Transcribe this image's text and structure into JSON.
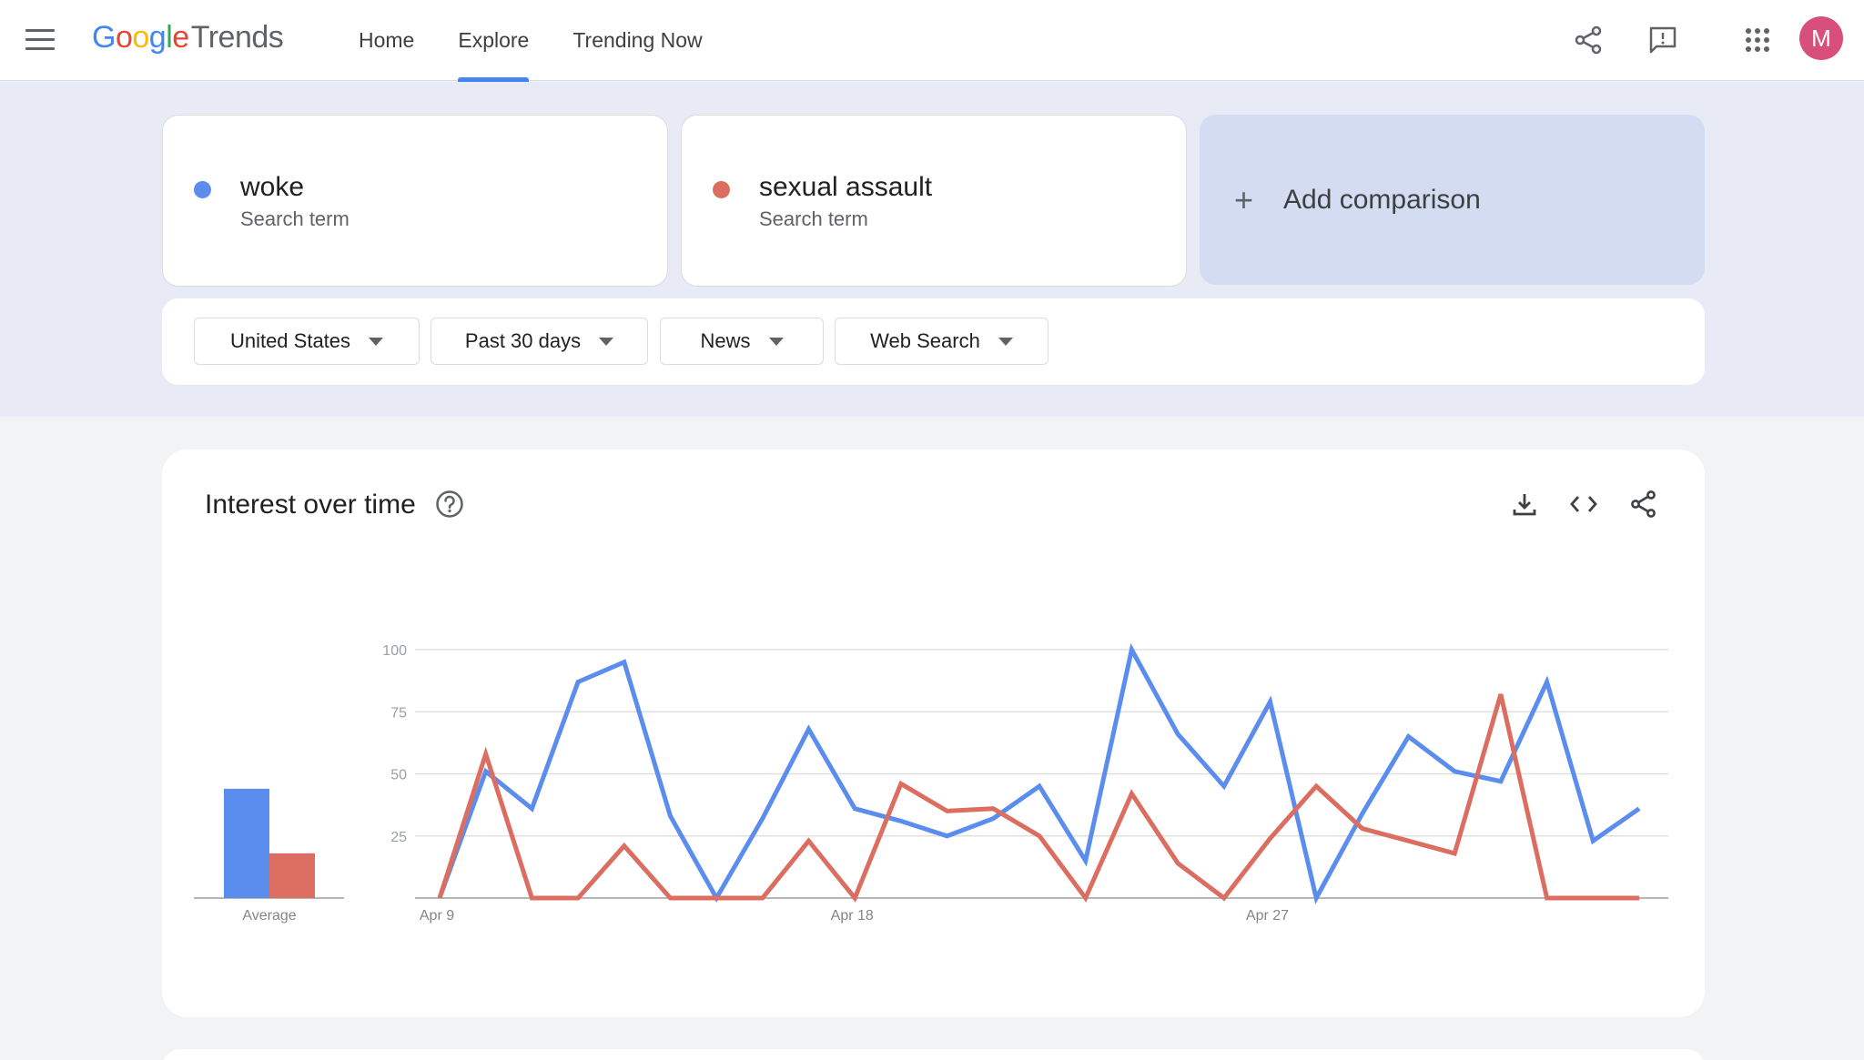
{
  "header": {
    "logo_google": [
      "G",
      "o",
      "o",
      "g",
      "l",
      "e"
    ],
    "logo_trends": "Trends",
    "nav": [
      {
        "label": "Home",
        "active": false
      },
      {
        "label": "Explore",
        "active": true
      },
      {
        "label": "Trending Now",
        "active": false
      }
    ],
    "avatar_letter": "M",
    "icons": [
      "menu-icon",
      "share-icon",
      "feedback-icon",
      "apps-icon"
    ]
  },
  "terms": [
    {
      "name": "woke",
      "sub": "Search term",
      "color": "#5b8dee"
    },
    {
      "name": "sexual assault",
      "sub": "Search term",
      "color": "#db6d61"
    }
  ],
  "add_comparison": {
    "plus": "+",
    "label": "Add comparison"
  },
  "filters": [
    {
      "label": "United States"
    },
    {
      "label": "Past 30 days"
    },
    {
      "label": "News"
    },
    {
      "label": "Web Search"
    }
  ],
  "interest_card": {
    "title": "Interest over time",
    "icons": [
      "help-icon",
      "download-icon",
      "embed-icon",
      "share-icon"
    ]
  },
  "chart_data": {
    "type": "line",
    "title": "",
    "xlabel": "",
    "ylabel": "",
    "ylim": [
      0,
      100
    ],
    "yticks": [
      "100",
      "75",
      "50",
      "25"
    ],
    "xtick_labels": [
      {
        "label": "Apr 9",
        "index": 0
      },
      {
        "label": "Apr 18",
        "index": 9
      },
      {
        "label": "Apr 27",
        "index": 18
      }
    ],
    "grid": true,
    "series": [
      {
        "name": "woke",
        "color": "#5b8dee",
        "values": [
          0,
          51,
          36,
          87,
          95,
          33,
          0,
          32,
          68,
          36,
          31,
          25,
          32,
          45,
          15,
          100,
          66,
          45,
          79,
          0,
          34,
          65,
          51,
          47,
          87,
          23,
          36
        ]
      },
      {
        "name": "sexual assault",
        "color": "#db6d61",
        "values": [
          0,
          58,
          0,
          0,
          21,
          0,
          0,
          0,
          23,
          0,
          46,
          35,
          36,
          25,
          0,
          42,
          14,
          0,
          24,
          45,
          28,
          23,
          18,
          82,
          0,
          0,
          0
        ]
      }
    ],
    "average": {
      "label": "Average",
      "values": [
        {
          "name": "woke",
          "value": 44,
          "color": "#5b8dee"
        },
        {
          "name": "sexual assault",
          "value": 18,
          "color": "#db6d61"
        }
      ]
    }
  }
}
